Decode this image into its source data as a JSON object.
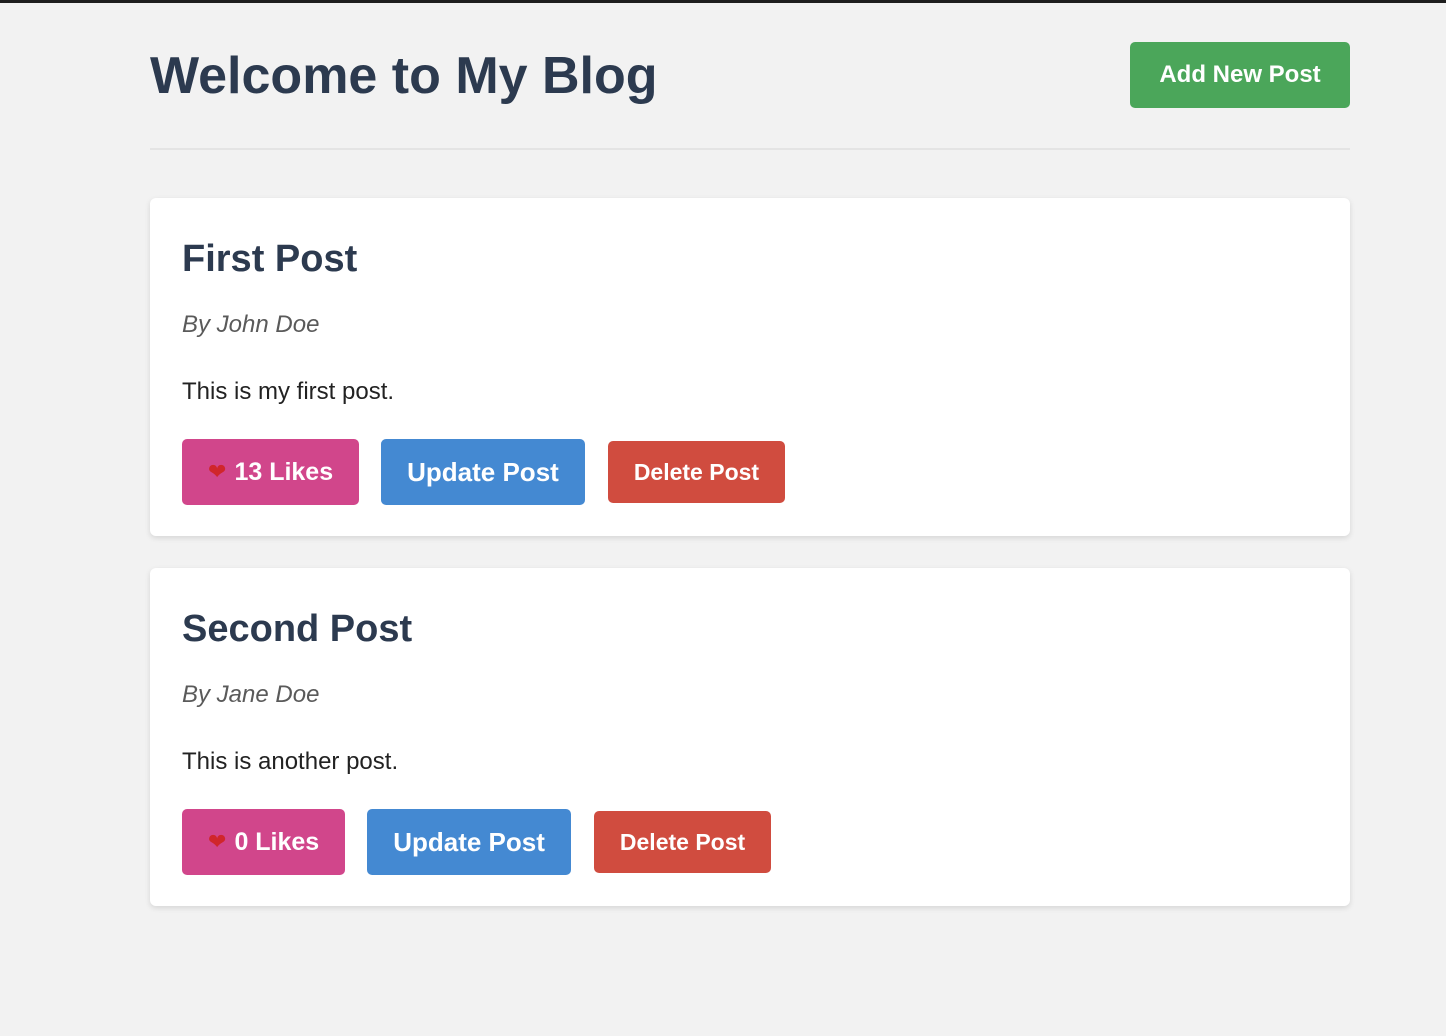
{
  "header": {
    "title": "Welcome to My Blog",
    "add_button_label": "Add New Post"
  },
  "posts": [
    {
      "title": "First Post",
      "author": "By John Doe",
      "body": "This is my first post.",
      "likes_label": "13 Likes",
      "likes_count": 13,
      "update_label": "Update Post",
      "delete_label": "Delete Post"
    },
    {
      "title": "Second Post",
      "author": "By Jane Doe",
      "body": "This is another post.",
      "likes_label": "0 Likes",
      "likes_count": 0,
      "update_label": "Update Post",
      "delete_label": "Delete Post"
    }
  ],
  "icons": {
    "like_icon": "heart-icon"
  },
  "colors": {
    "add_button": "#4ba65a",
    "like_button": "#d1468b",
    "update_button": "#4489d2",
    "delete_button": "#d04c3f",
    "title_text": "#2c3a4f",
    "page_background": "#f2f2f2"
  }
}
